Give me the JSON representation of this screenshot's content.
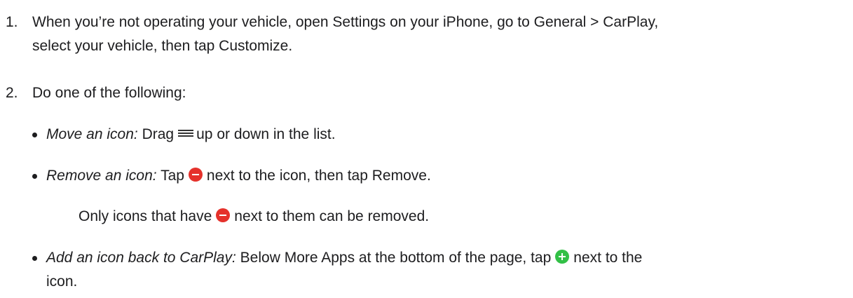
{
  "steps": [
    {
      "number": "1.",
      "text_line1": "When you’re not operating your vehicle, open Settings on your iPhone, go to General > CarPlay,",
      "text_line2": "select your vehicle, then tap Customize."
    },
    {
      "number": "2.",
      "text": "Do one of the following:"
    }
  ],
  "bullets": {
    "move": {
      "label": "Move an icon:",
      "before": "Drag",
      "icon": "reorder-icon",
      "after": "up or down in the list."
    },
    "remove": {
      "label": "Remove an icon:",
      "before": "Tap",
      "icon": "remove-circle-icon",
      "after": "next to the icon, then tap Remove."
    },
    "remove_note": {
      "before": "Only icons that have",
      "icon": "remove-circle-icon",
      "after": "next to them can be removed."
    },
    "add": {
      "label": "Add an icon back to CarPlay:",
      "before": "Below More Apps at the bottom of the page, tap",
      "icon": "add-circle-icon",
      "after_line1": "next to the",
      "after_line2": "icon."
    }
  },
  "colors": {
    "text": "#1d1d1f",
    "remove_icon": "#e5312b",
    "add_icon": "#32c046"
  }
}
